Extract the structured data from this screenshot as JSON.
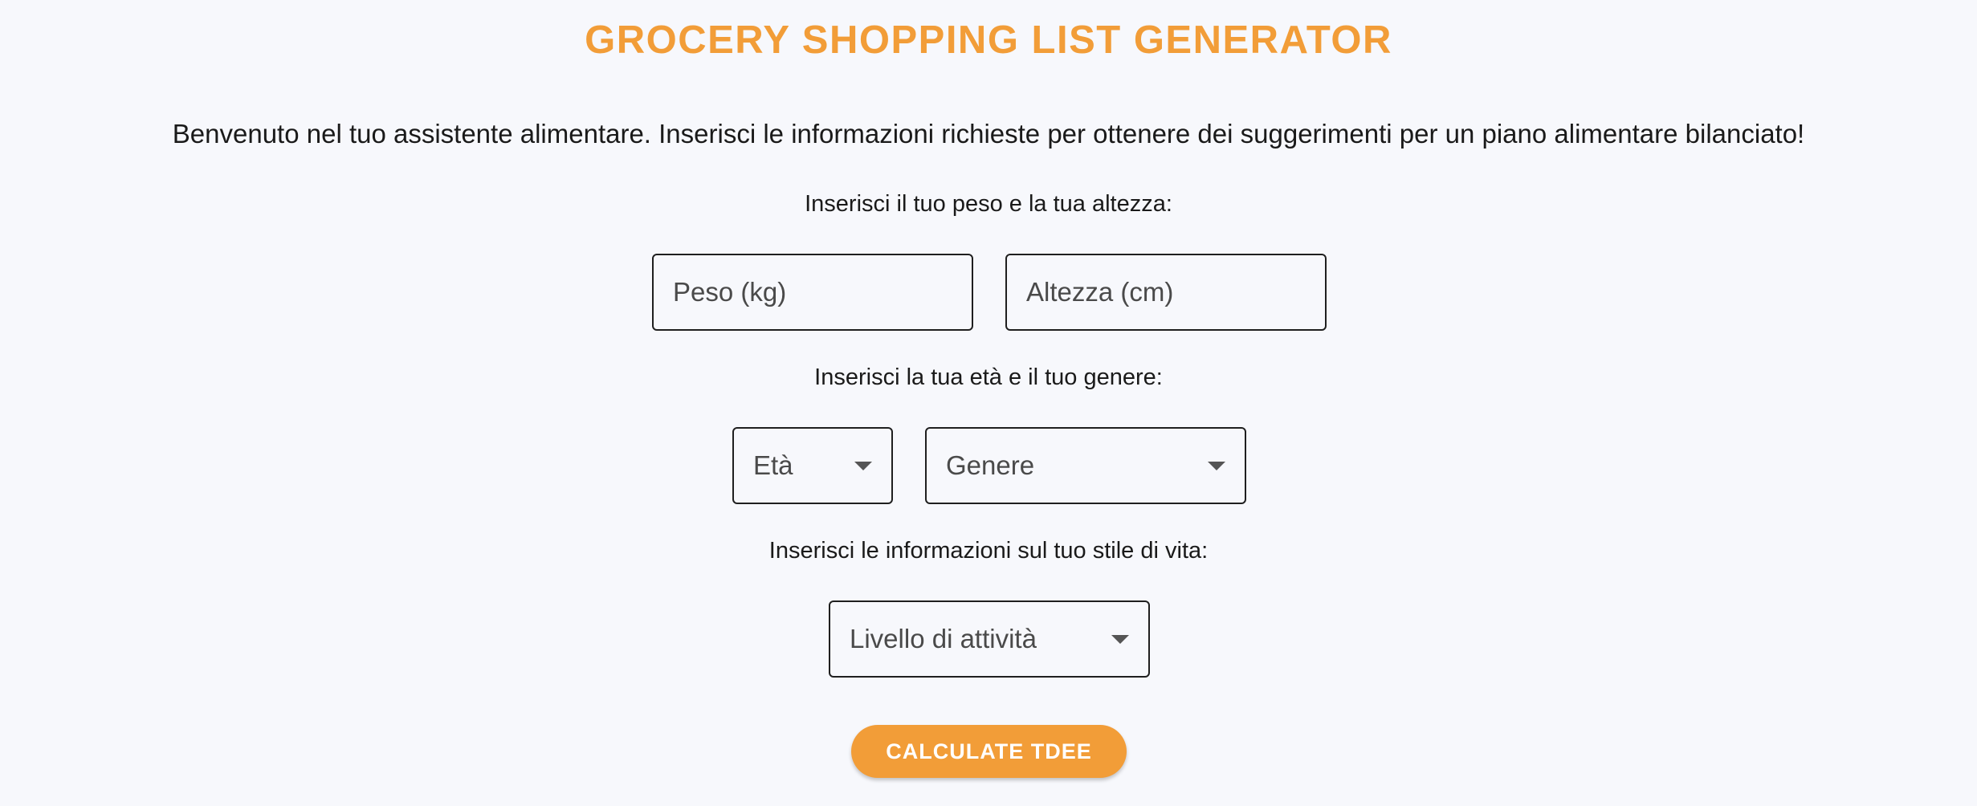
{
  "app": {
    "title": "GROCERY SHOPPING LIST GENERATOR",
    "intro": "Benvenuto nel tuo assistente alimentare. Inserisci le informazioni richieste per ottenere dei suggerimenti per un piano alimentare bilanciato!"
  },
  "body_metrics": {
    "label": "Inserisci il tuo peso e la tua altezza:",
    "weight_placeholder": "Peso (kg)",
    "height_placeholder": "Altezza (cm)"
  },
  "demographics": {
    "label": "Inserisci la tua età e il tuo genere:",
    "age_select": "Età",
    "gender_select": "Genere"
  },
  "lifestyle": {
    "label": "Inserisci le informazioni sul tuo stile di vita:",
    "activity_select": "Livello di attività"
  },
  "actions": {
    "calculate_label": "CALCULATE TDEE"
  },
  "colors": {
    "accent": "#f29d38",
    "background": "#f7f8fc",
    "border": "#1f1f1f"
  }
}
